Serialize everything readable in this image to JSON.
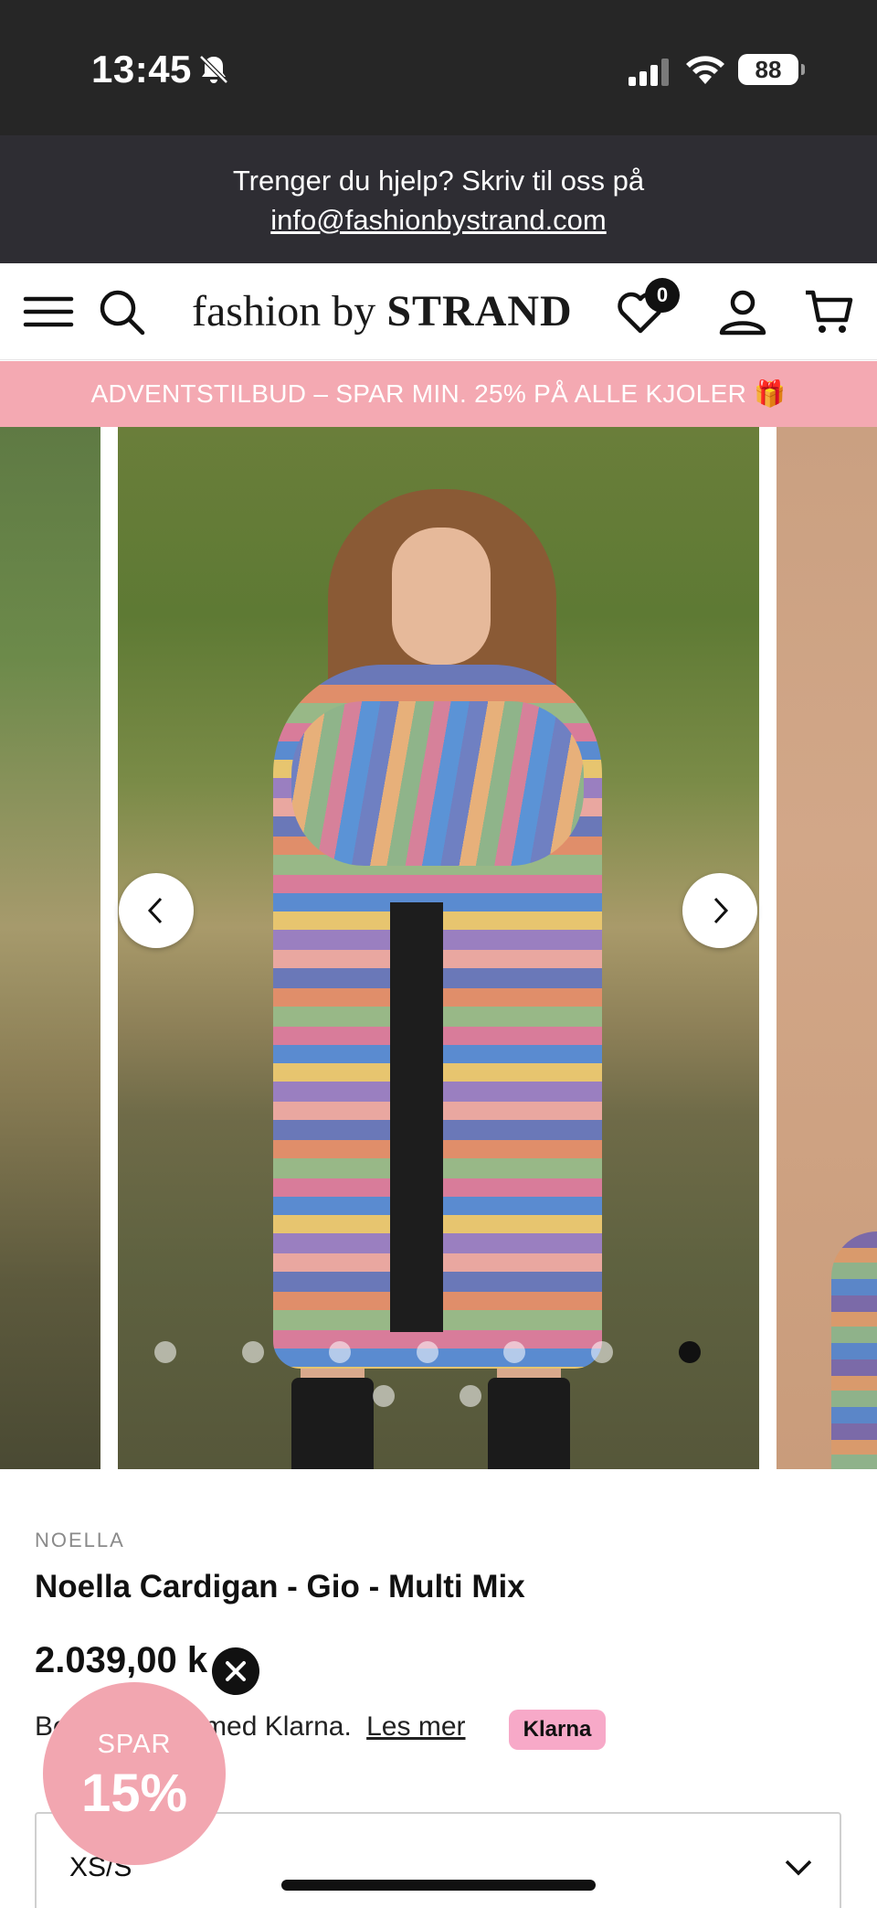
{
  "status_bar": {
    "time": "13:45",
    "battery": "88",
    "icons": [
      "bell-slash-icon",
      "cellular-signal-icon",
      "wifi-icon",
      "battery-icon"
    ]
  },
  "help_bar": {
    "text": "Trenger du hjelp? Skriv til oss på",
    "email": "info@fashionbystrand.com"
  },
  "header": {
    "logo_light": "fashion by ",
    "logo_bold": "STRAND",
    "wishlist_count": "0",
    "icons": [
      "menu-icon",
      "search-icon",
      "heart-icon",
      "account-icon",
      "cart-icon"
    ]
  },
  "promo": {
    "text": "ADVENTSTILBUD – SPAR MIN. 25% PÅ ALLE KJOLER 🎁"
  },
  "carousel": {
    "total_slides": 9,
    "active_index": 7,
    "prev_icon": "chevron-left-icon",
    "next_icon": "chevron-right-icon"
  },
  "product": {
    "brand": "NOELLA",
    "title": "Noella Cardigan - Gio - Multi Mix",
    "price": "2.039,00 k",
    "klarna_text": "Bet",
    "klarna_text_mid": "med Klarna.",
    "klarna_link": "Les mer",
    "klarna_badge": "Klarna",
    "size_selected": "XS/S"
  },
  "discount_badge": {
    "line1": "SPAR",
    "line2": "15%"
  },
  "colors": {
    "status_bg": "#262626",
    "help_bg": "#2e2d33",
    "promo_bg": "#f4a9b2",
    "badge_pink": "#f2a6b0",
    "klarna_pink": "#f7a9c8"
  }
}
